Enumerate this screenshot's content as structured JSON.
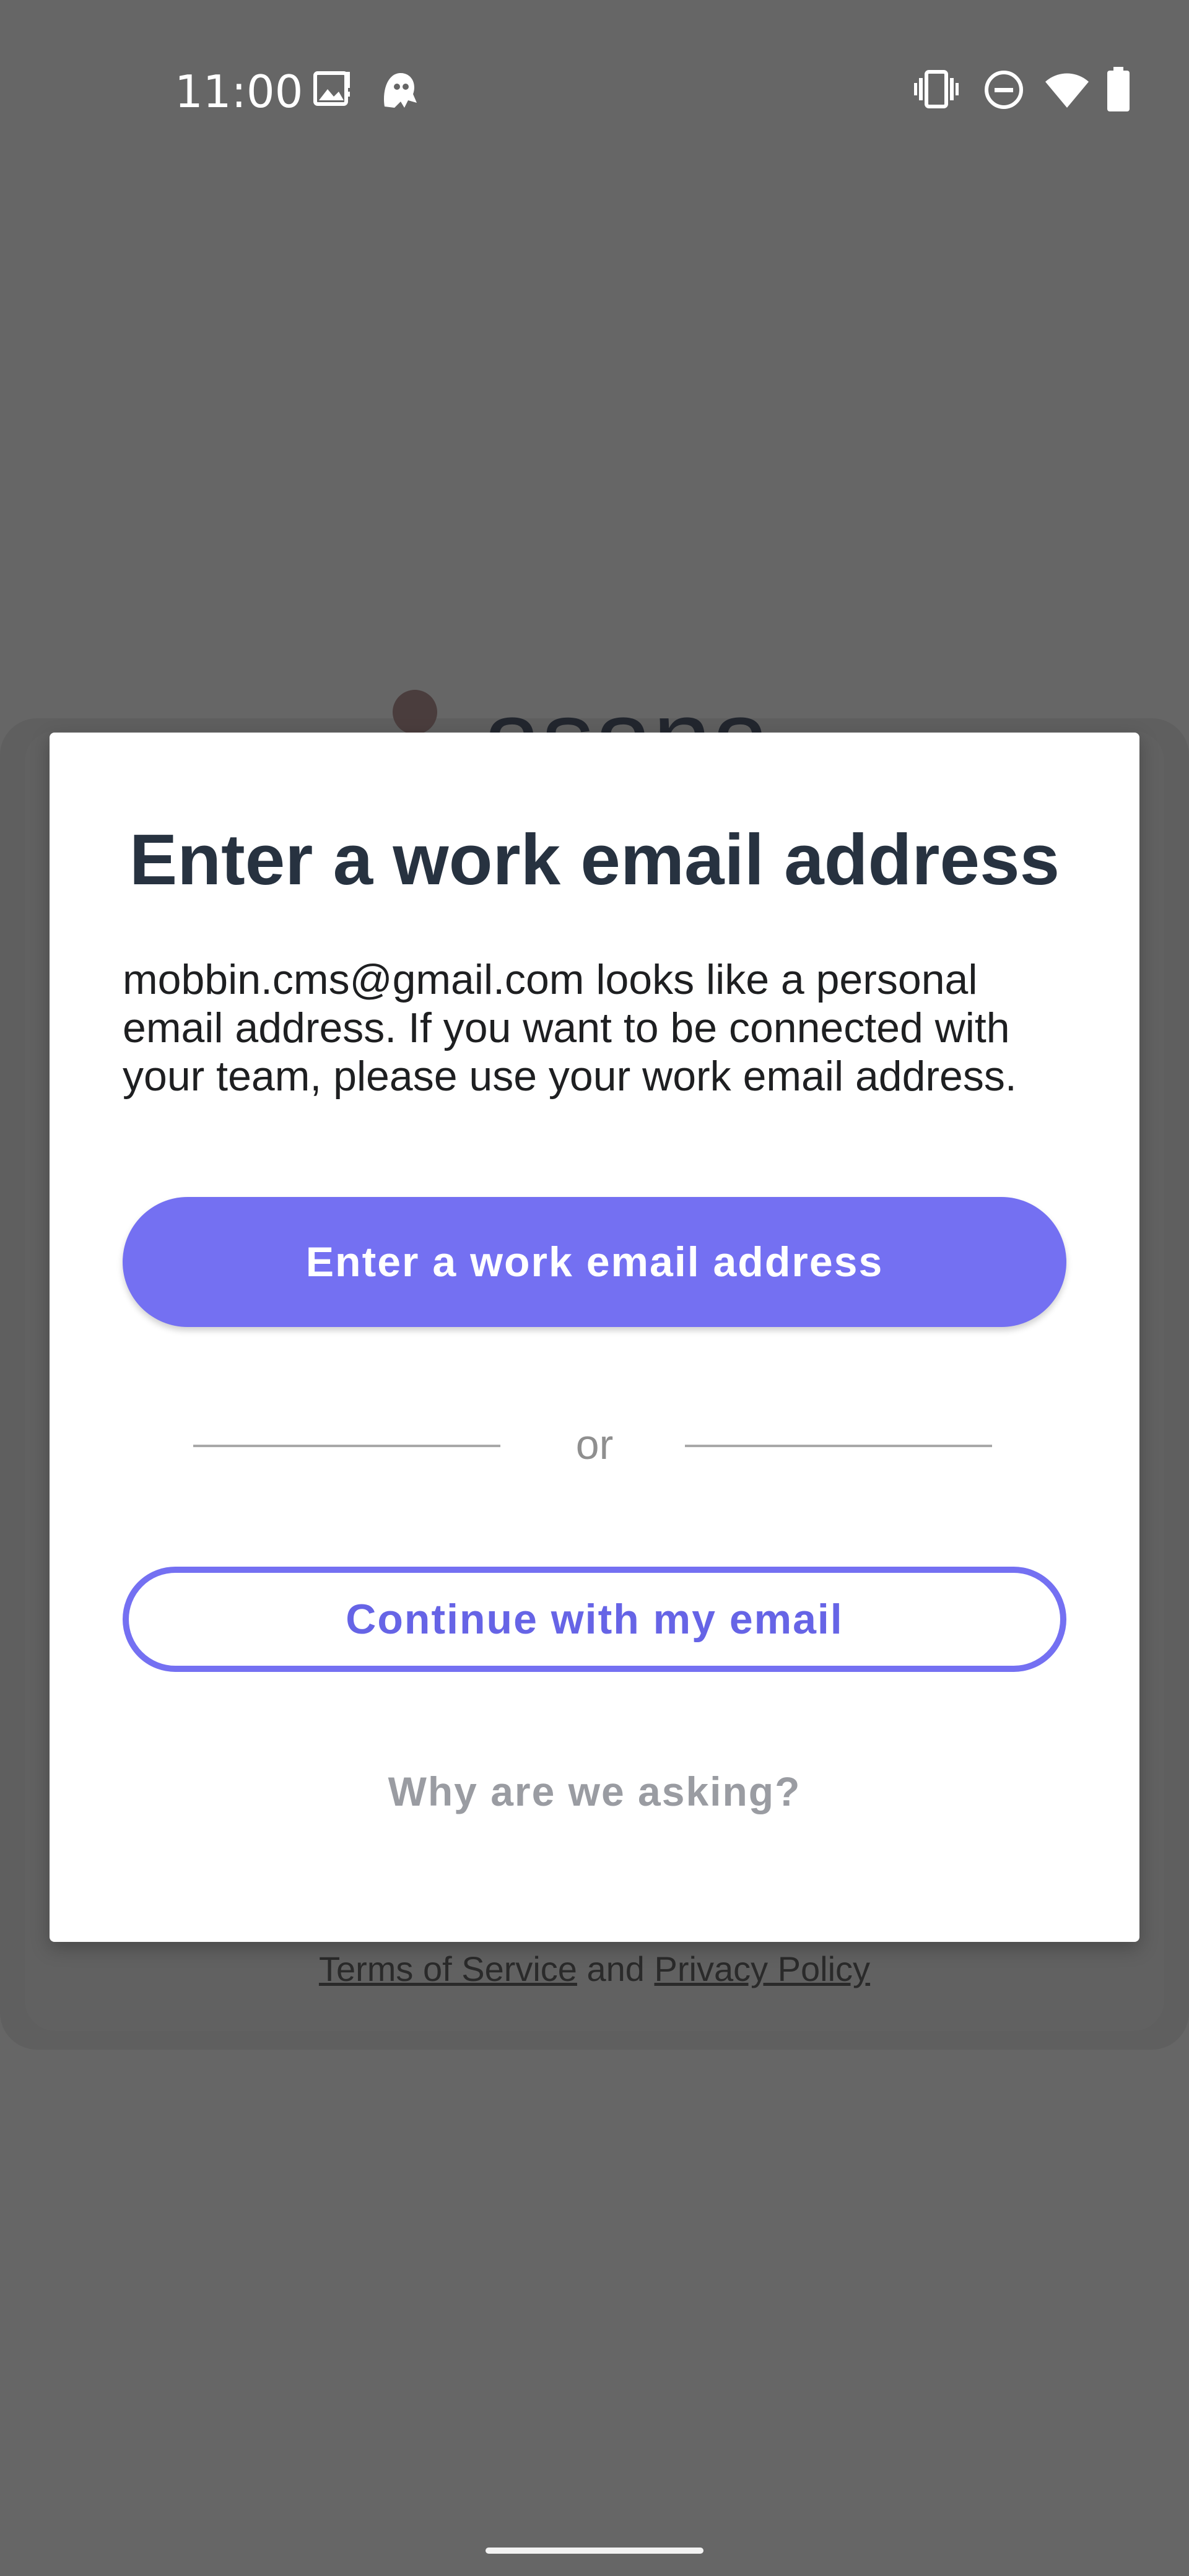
{
  "status_bar": {
    "time": "11:00",
    "icons": [
      "image-notification-icon",
      "ghost-notification-icon",
      "vibrate-icon",
      "do-not-disturb-icon",
      "wifi-icon",
      "battery-icon"
    ]
  },
  "background": {
    "logo_text": "asana",
    "legal": {
      "terms": "Terms of Service",
      "and": "and",
      "privacy": "Privacy Policy"
    }
  },
  "dialog": {
    "title": "Enter a work email address",
    "body": "mobbin.cms@gmail.com looks like a personal email address. If you want to be connected with your team, please use your work email address.",
    "primary_button": "Enter a work email address",
    "divider_text": "or",
    "secondary_button": "Continue with my email",
    "why_link": "Why are we asking?"
  },
  "colors": {
    "scrim": "#666666",
    "accent": "#7470f2",
    "title": "#273240",
    "muted": "#9a9ca2"
  }
}
